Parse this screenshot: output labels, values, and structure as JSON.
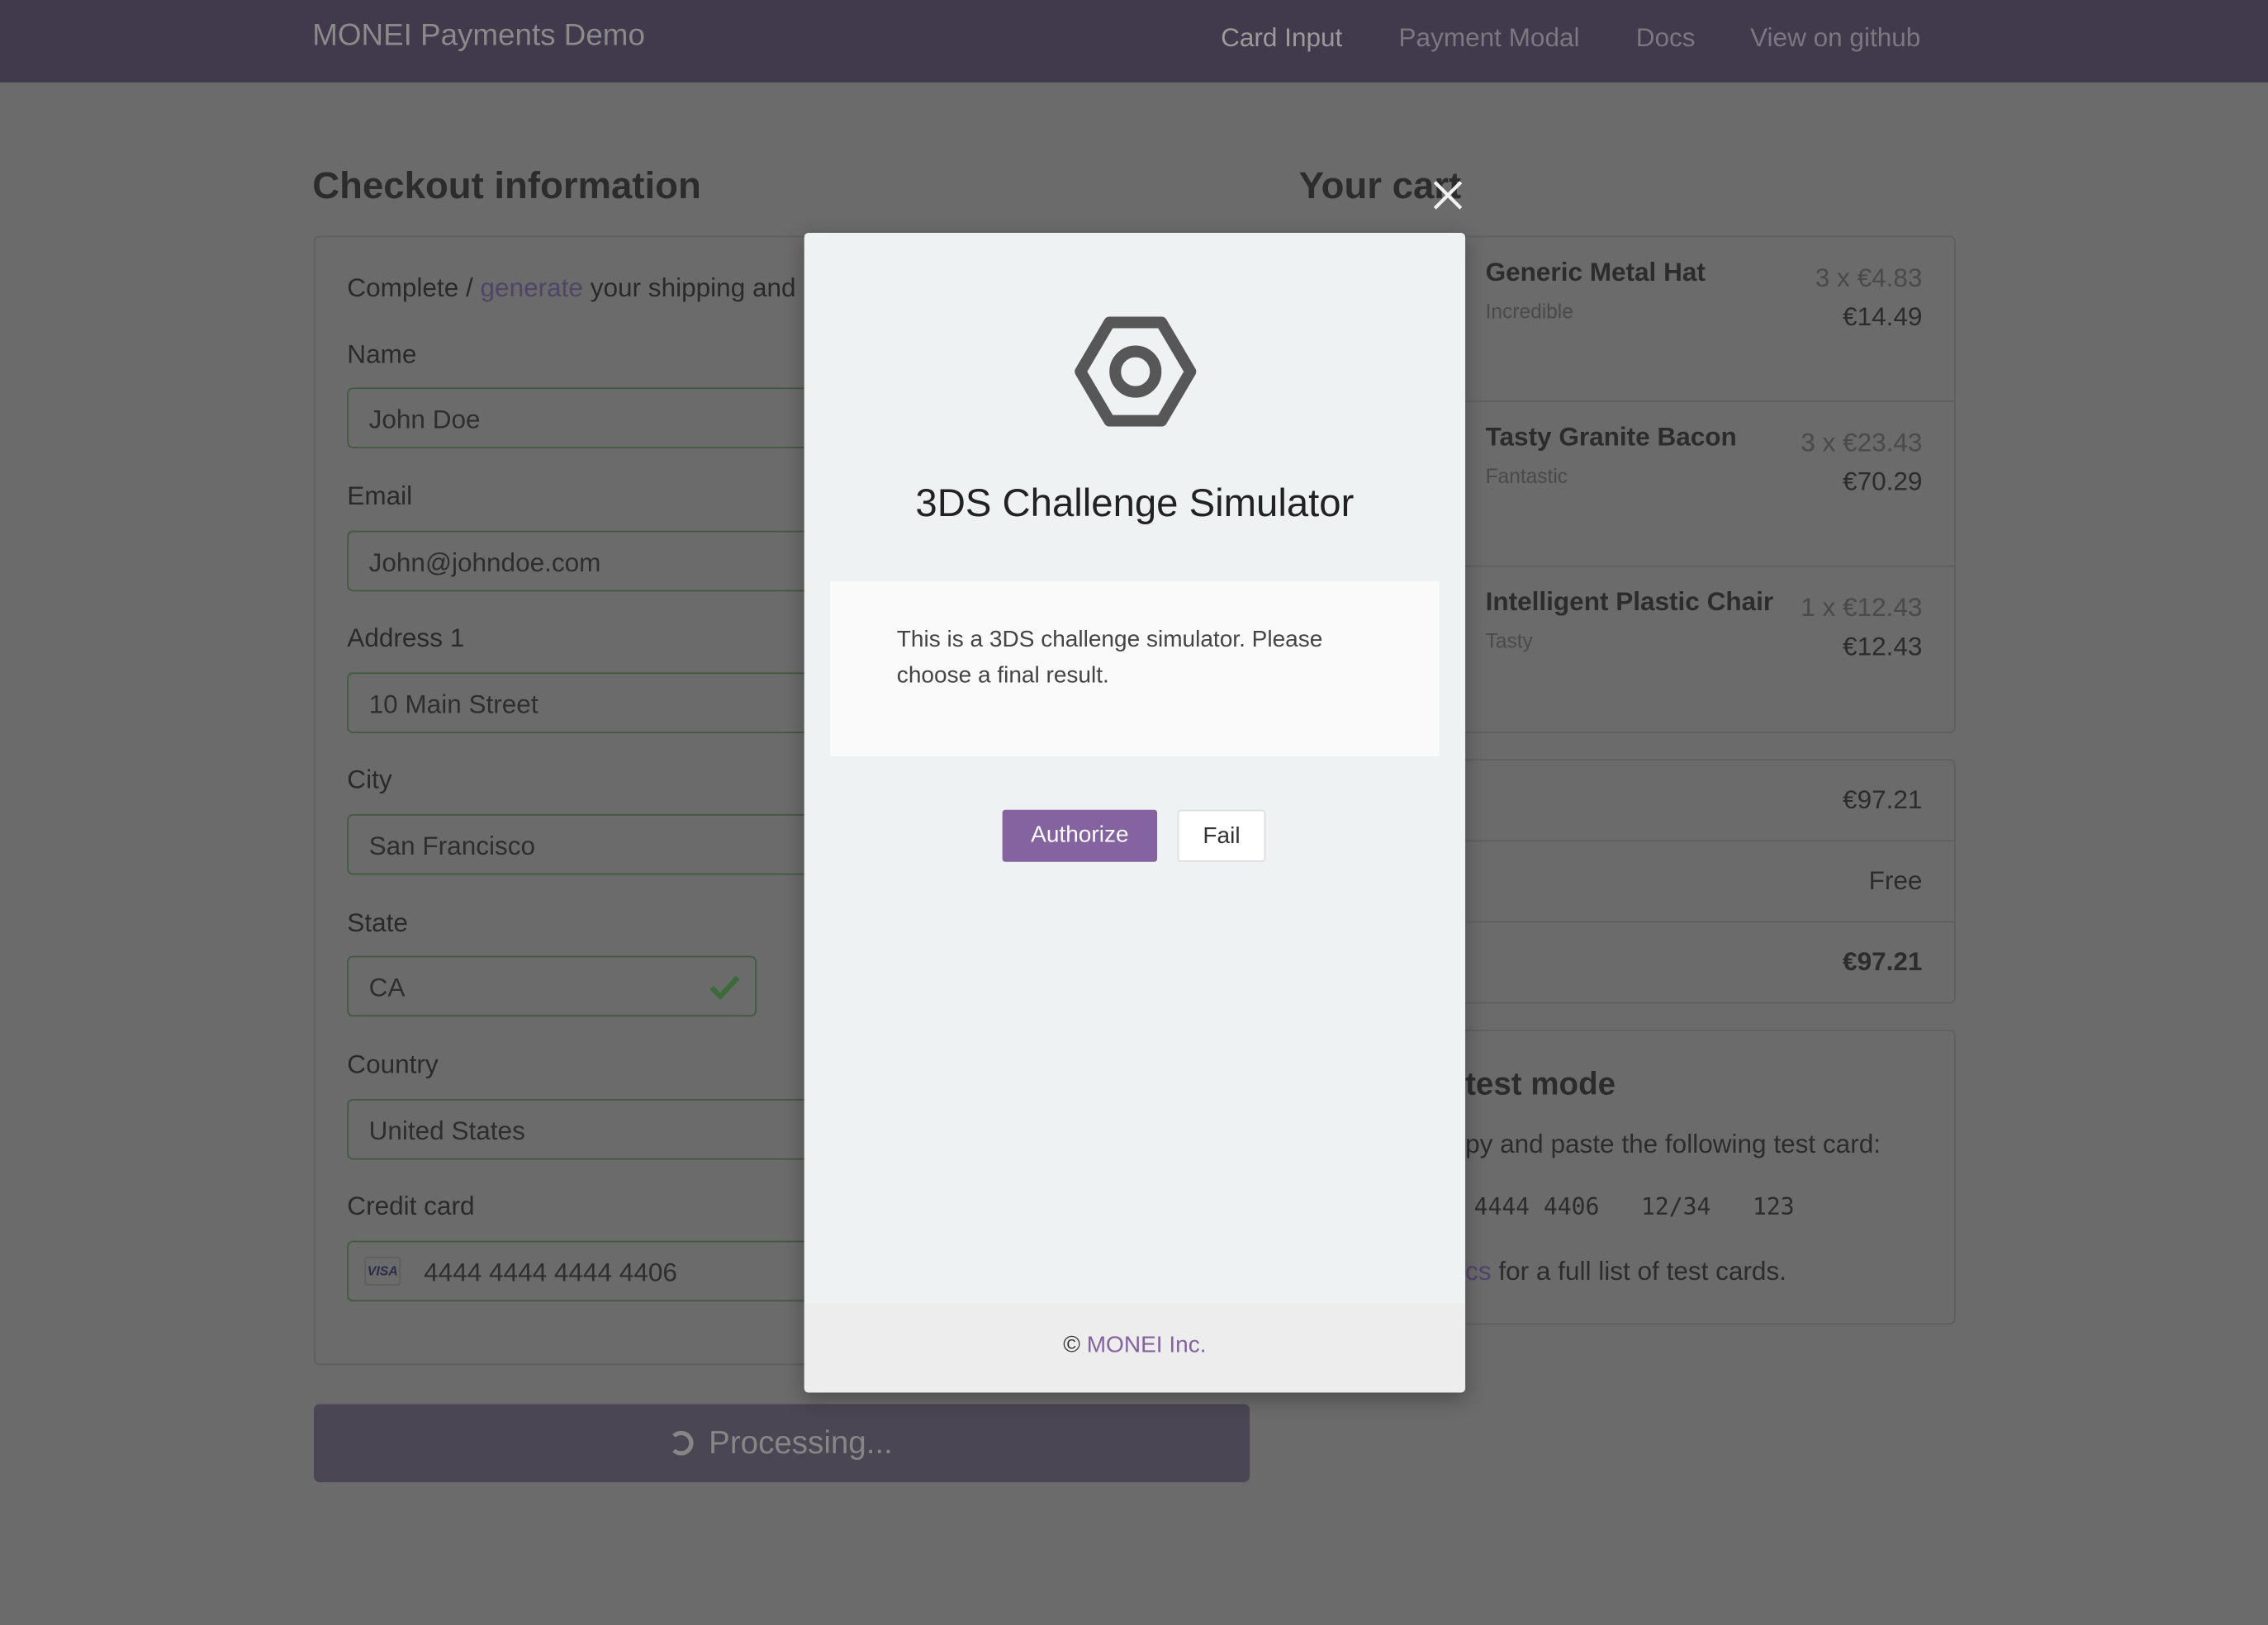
{
  "navbar": {
    "brand": "MONEI Payments Demo",
    "links": [
      {
        "label": "Card Input",
        "active": true
      },
      {
        "label": "Payment Modal",
        "active": false
      },
      {
        "label": "Docs",
        "active": false
      },
      {
        "label": "View on github",
        "active": false
      }
    ]
  },
  "checkout": {
    "title": "Checkout information",
    "intro_prefix": "Complete / ",
    "intro_link": "generate",
    "intro_suffix": " your shipping and",
    "fields": [
      {
        "label": "Name",
        "value": "John Doe"
      },
      {
        "label": "Email",
        "value": "John@johndoe.com"
      },
      {
        "label": "Address 1",
        "value": "10 Main Street"
      },
      {
        "label": "City",
        "value": "San Francisco"
      },
      {
        "label": "State",
        "value": "CA"
      },
      {
        "label": "Country",
        "value": "United States"
      }
    ],
    "card_label": "Credit card",
    "card_brand": "VISA",
    "card_number": "4444 4444 4444 4406",
    "submit_label": "Processing...",
    "spinner_icon": "spinner-icon"
  },
  "cart": {
    "title": "Your cart",
    "items": [
      {
        "name": "Generic Metal Hat",
        "desc": "Incredible",
        "qty_price": "3 x €4.83",
        "total": "€14.49"
      },
      {
        "name": "Tasty Granite Bacon",
        "desc": "Fantastic",
        "qty_price": "3 x €23.43",
        "total": "€70.29"
      },
      {
        "name": "Intelligent Plastic Chair",
        "desc": "Tasty",
        "qty_price": "1 x €12.43",
        "total": "€12.43"
      }
    ],
    "summary": [
      "€97.21",
      "Free",
      "€97.21"
    ]
  },
  "testmode": {
    "title": "test mode",
    "line1": "py and paste the following test card:",
    "card": "4444 4406   12/34   123",
    "line2_link": "cs",
    "line2": " for a full list of test cards."
  },
  "modal": {
    "icon": "hexagon-nut-icon",
    "title": "3DS Challenge Simulator",
    "message": "This is a 3DS challenge simulator. Please choose a final result.",
    "authorize_label": "Authorize",
    "fail_label": "Fail",
    "footer_symbol": "©",
    "footer_link": "MONEI Inc.",
    "accent": "#8463a0"
  }
}
